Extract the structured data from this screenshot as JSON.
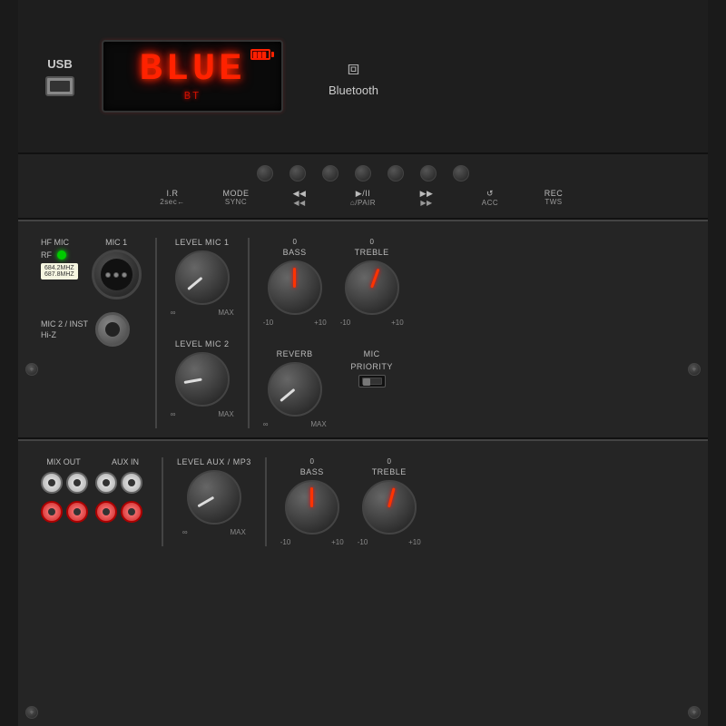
{
  "panel": {
    "background_color": "#252525",
    "border_color": "#111"
  },
  "top": {
    "usb_label": "USB",
    "led_text": "BLUE",
    "led_sub": "BT",
    "bluetooth_label": "Bluetooth",
    "battery_cells": 3
  },
  "controls": {
    "buttons": [
      "btn1",
      "btn2",
      "btn3",
      "btn4",
      "btn5",
      "btn6"
    ],
    "labels_top": [
      "I.R",
      "MODE",
      "◀◀",
      "▶/II",
      "▶▶",
      "↺",
      "REC"
    ],
    "labels_bot": [
      "2sec←",
      "SYNC",
      "◀◀",
      "⌂/PAIR",
      "▶▶",
      "ACC",
      "TWS"
    ]
  },
  "mic_section": {
    "hf_mic_label": "HF MIC",
    "mic1_label": "MIC 1",
    "mic2_label": "MIC 2 / INST\nHi-Z",
    "rf_label": "RF",
    "freq1": "684.2MHZ",
    "freq2": "687.8MHZ",
    "level_mic1_label": "LEVEL MIC 1",
    "level_mic2_label": "LEVEL MIC 2",
    "bass_label": "BASS",
    "treble_label": "TREBLE",
    "reverb_label": "REVERB",
    "mic_priority_label": "MIC\nPRIORITY",
    "knob_min": "∞",
    "knob_max": "MAX",
    "bass_min": "-10",
    "bass_zero": "0",
    "bass_max": "+10",
    "treble_min": "-10",
    "treble_zero": "0",
    "treble_max": "+10"
  },
  "bottom_section": {
    "mix_out_label": "MIX OUT",
    "aux_in_label": "AUX IN",
    "level_aux_label": "LEVEL AUX / MP3",
    "bass_label": "BASS",
    "treble_label": "TREBLE",
    "knob_min": "∞",
    "knob_max": "MAX",
    "bass_min": "-10",
    "bass_zero": "0",
    "bass_max": "+10",
    "treble_min": "-10",
    "treble_zero": "0",
    "treble_max": "+10"
  }
}
